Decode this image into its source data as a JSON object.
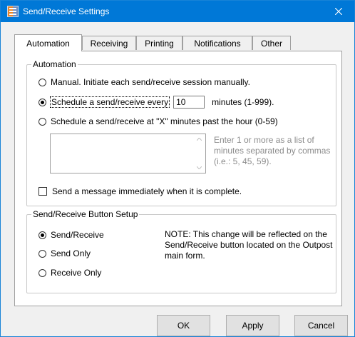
{
  "window": {
    "title": "Send/Receive Settings"
  },
  "tabs": [
    {
      "label": "Automation",
      "active": true
    },
    {
      "label": "Receiving",
      "active": false
    },
    {
      "label": "Printing",
      "active": false
    },
    {
      "label": "Notifications",
      "active": false
    },
    {
      "label": "Other",
      "active": false
    }
  ],
  "automation": {
    "legend": "Automation",
    "manual_label": "Manual.  Initiate each send/receive session manually.",
    "schedule_every_label": "Schedule a send/receive every",
    "interval_value": "10",
    "interval_units": "minutes (1-999).",
    "schedule_past_hour_label": "Schedule a send/receive at \"X\" minutes past the hour (0-59)",
    "minutes_list_hint": "Enter 1 or more as a list of minutes separated by commas   (i.e.: 5, 45, 59).",
    "send_immediately_label": "Send a message immediately when it is complete.",
    "selected": "schedule_every"
  },
  "button_setup": {
    "legend": "Send/Receive Button Setup",
    "options": [
      "Send/Receive",
      "Send Only",
      "Receive Only"
    ],
    "selected": "Send/Receive",
    "note": "NOTE:  This change will be reflected on the Send/Receive button located on the Outpost main form."
  },
  "buttons": {
    "ok": "OK",
    "apply": "Apply",
    "cancel": "Cancel"
  },
  "colors": {
    "titlebar": "#0078d7",
    "hint_text": "#8c8c8c"
  }
}
